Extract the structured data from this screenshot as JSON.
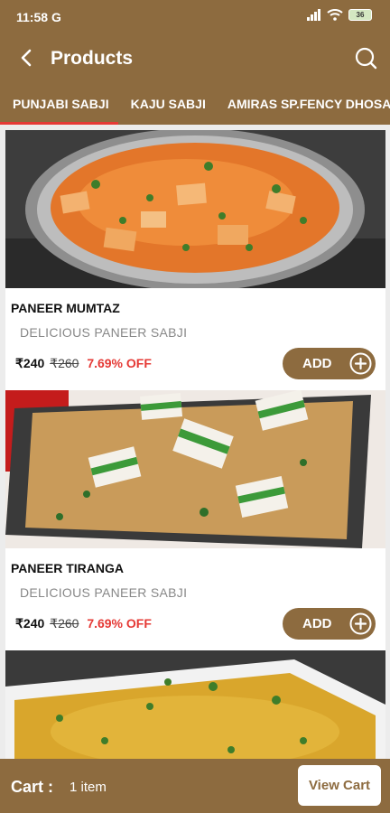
{
  "status_bar": {
    "time": "11:58",
    "g_label": "G",
    "battery": "36"
  },
  "toolbar": {
    "title": "Products",
    "back_icon": "back-arrow-icon",
    "search_icon": "search-icon"
  },
  "tabs": [
    {
      "label": "PUNJABI SABJI",
      "active": true
    },
    {
      "label": "KAJU SABJI",
      "active": false
    },
    {
      "label": "AMIRAS SP.FENCY DHOSA",
      "active": false
    }
  ],
  "products": [
    {
      "name": "PANEER MUMTAZ",
      "description": "DELICIOUS PANEER SABJI",
      "price": "₹240",
      "old_price": "₹260",
      "discount": "7.69% OFF",
      "add_label": "ADD"
    },
    {
      "name": "PANEER TIRANGA",
      "description": "DELICIOUS PANEER SABJI",
      "price": "₹240",
      "old_price": "₹260",
      "discount": "7.69% OFF",
      "add_label": "ADD"
    }
  ],
  "cart": {
    "label": "Cart :",
    "count": "1 item",
    "button": "View Cart"
  },
  "colors": {
    "primary": "#8d6b3f",
    "accent": "#e53935",
    "background": "#ececec"
  }
}
